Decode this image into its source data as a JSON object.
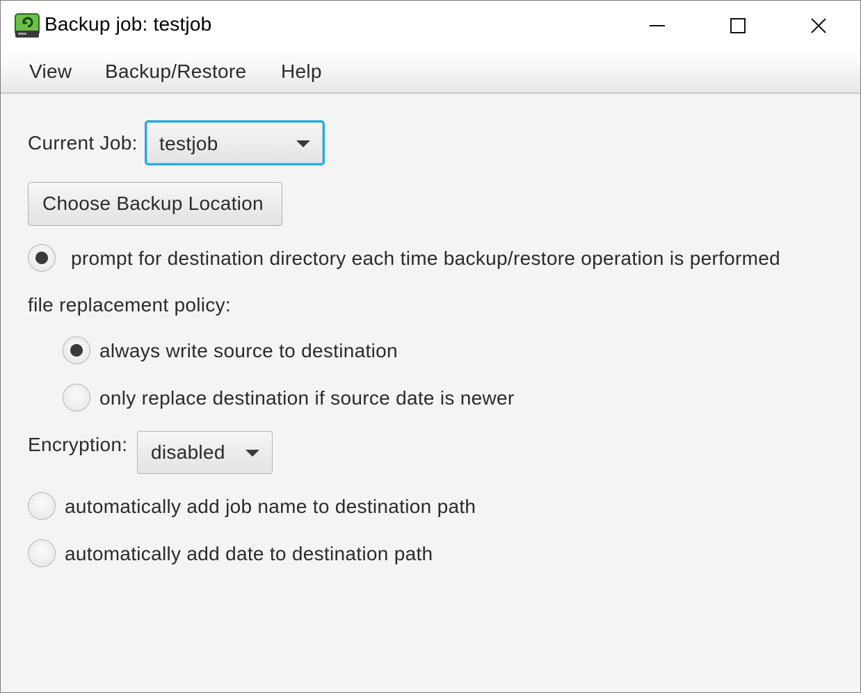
{
  "window": {
    "title": "Backup job: testjob"
  },
  "menu": {
    "items": [
      "View",
      "Backup/Restore",
      "Help"
    ]
  },
  "job": {
    "label": "Current Job:",
    "selected": "testjob"
  },
  "choose_location_button": "Choose Backup Location",
  "prompt_option": {
    "label": "prompt for destination directory each time backup/restore operation is performed",
    "checked": true
  },
  "replacement_policy": {
    "label": "file replacement policy:",
    "options": [
      {
        "label": "always write source to destination",
        "checked": true
      },
      {
        "label": "only replace destination if source date is newer",
        "checked": false
      }
    ]
  },
  "encryption": {
    "label": "Encryption:",
    "selected": "disabled"
  },
  "path_options": [
    {
      "label": "automatically add job name to destination path",
      "checked": false
    },
    {
      "label": "automatically add date to destination path",
      "checked": false
    }
  ],
  "icons": [
    "app-drive-icon",
    "minimize-icon",
    "maximize-icon",
    "close-icon",
    "chevron-down-icon"
  ]
}
